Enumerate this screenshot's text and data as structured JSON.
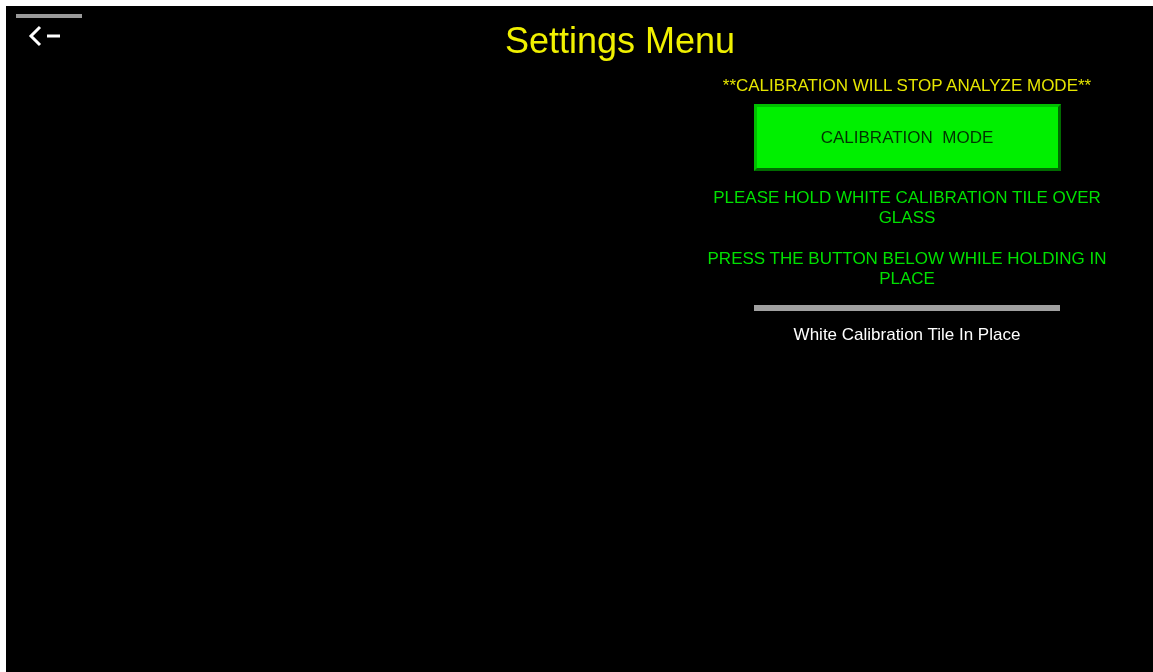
{
  "header": {
    "title": "Settings Menu"
  },
  "calibration": {
    "warning": "**CALIBRATION WILL STOP ANALYZE MODE**",
    "mode_button": "CALIBRATION  MODE",
    "instructions": [
      "PLEASE HOLD WHITE CALIBRATION TILE OVER GLASS",
      "PRESS THE BUTTON BELOW WHILE HOLDING IN PLACE"
    ],
    "tile_button": "White Calibration Tile In Place"
  }
}
